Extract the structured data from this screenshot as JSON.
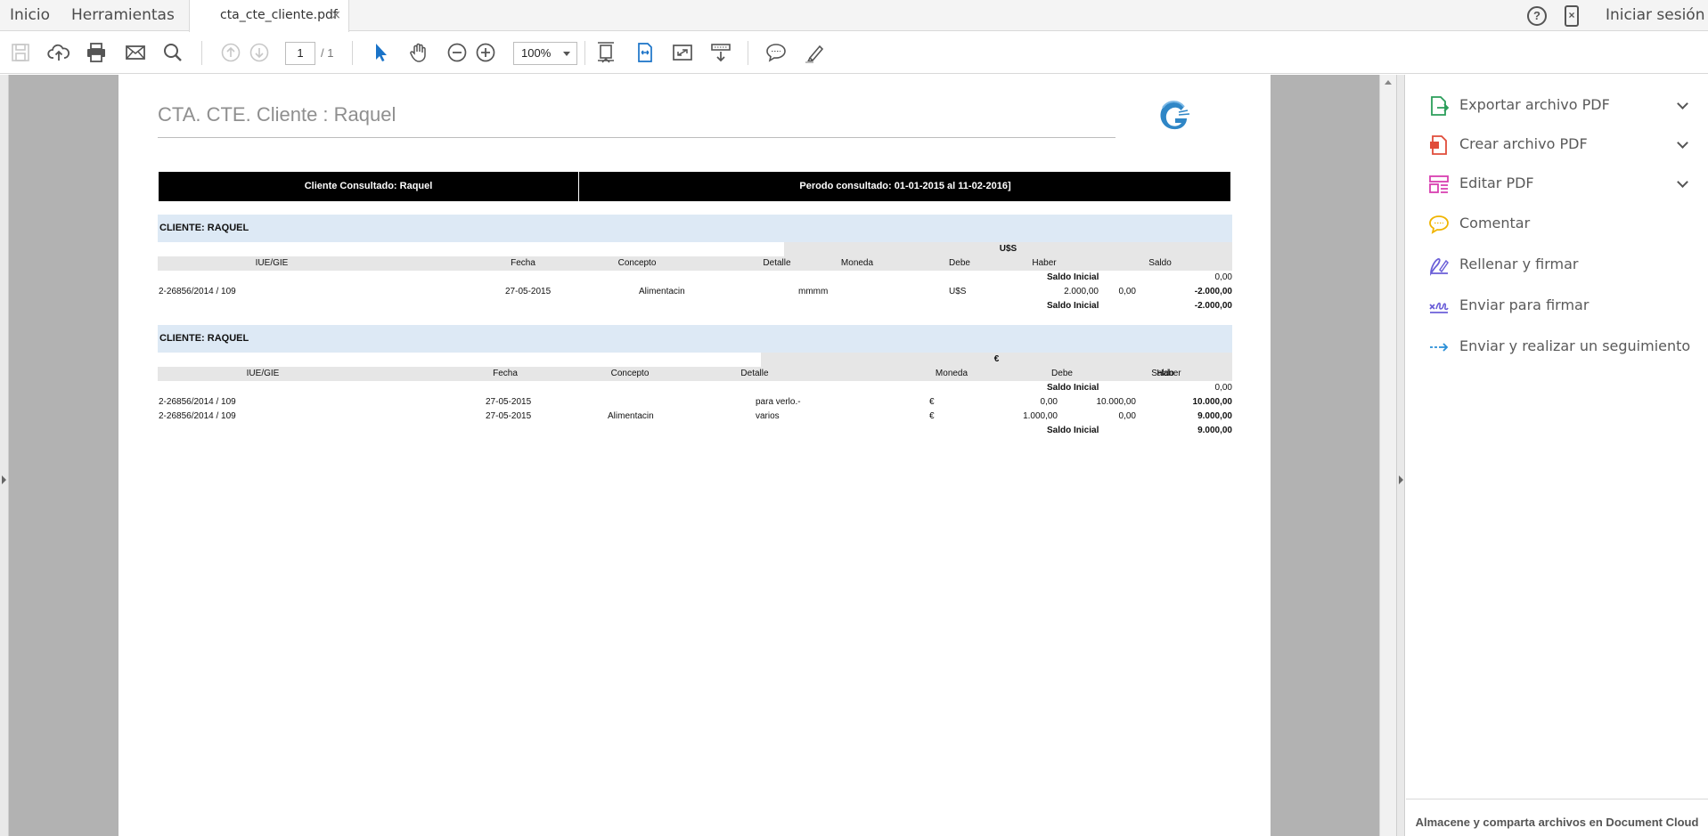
{
  "topbar": {
    "home": "Inicio",
    "tools": "Herramientas",
    "file_tab": "cta_cte_cliente.pdf",
    "close_glyph": "×",
    "help_glyph": "?",
    "sign_in": "Iniciar sesión"
  },
  "toolbar": {
    "page_current": "1",
    "page_total": "/ 1",
    "zoom": "100%",
    "icons": [
      "save-icon",
      "upload-cloud-icon",
      "print-icon",
      "email-icon",
      "search-icon",
      "page-up-icon",
      "page-down-icon",
      "select-arrow-icon",
      "hand-icon",
      "zoom-out-icon",
      "zoom-in-icon",
      "fit-page-icon",
      "fit-width-icon",
      "fullscreen-icon",
      "read-mode-icon",
      "comment-icon",
      "highlight-pen-icon"
    ]
  },
  "panel": {
    "items": [
      {
        "label": "Exportar archivo PDF",
        "icon": "export-pdf-icon",
        "color": "#2b9e5a",
        "expandable": true
      },
      {
        "label": "Crear archivo PDF",
        "icon": "create-pdf-icon",
        "color": "#e04c3a",
        "expandable": true
      },
      {
        "label": "Editar PDF",
        "icon": "edit-pdf-icon",
        "color": "#d83fb0",
        "expandable": true
      },
      {
        "label": "Comentar",
        "icon": "comment-bubble-icon",
        "color": "#f0b400",
        "expandable": false
      },
      {
        "label": "Rellenar y firmar",
        "icon": "fill-sign-icon",
        "color": "#6b5fd8",
        "expandable": false
      },
      {
        "label": "Enviar para firmar",
        "icon": "send-sign-icon",
        "color": "#6b5fd8",
        "expandable": false
      },
      {
        "label": "Enviar y realizar un seguimiento",
        "icon": "send-track-icon",
        "color": "#2a8fd8",
        "expandable": false
      }
    ],
    "footer": "Almacene y comparta archivos en Document Cloud"
  },
  "document": {
    "title": "CTA. CTE. Cliente : Raquel",
    "header_client": "Cliente Consultado: Raquel",
    "header_period": "Perodo consultado: 01-01-2015 al 11-02-2016]",
    "columns": [
      "IUE/GIE",
      "Fecha",
      "Concepto",
      "Detalle",
      "Moneda",
      "Debe",
      "Haber",
      "Saldo"
    ],
    "sections": [
      {
        "client": "CLIENTE: RAQUEL",
        "currency": "U$S",
        "opening": {
          "label": "Saldo Inicial",
          "saldo": "0,00"
        },
        "rows": [
          {
            "iue": "2-26856/2014 / 109",
            "fecha": "27-05-2015",
            "concepto": "Alimentacin",
            "detalle": "mmmm",
            "moneda": "U$S",
            "debe": "2.000,00",
            "haber": "0,00",
            "saldo": "-2.000,00"
          }
        ],
        "closing": {
          "label": "Saldo Inicial",
          "saldo": "-2.000,00"
        }
      },
      {
        "client": "CLIENTE: RAQUEL",
        "currency": "€",
        "opening": {
          "label": "Saldo Inicial",
          "saldo": "0,00"
        },
        "rows": [
          {
            "iue": "2-26856/2014 / 109",
            "fecha": "27-05-2015",
            "concepto": "",
            "detalle": "para verlo.-",
            "moneda": "€",
            "debe": "0,00",
            "haber": "10.000,00",
            "saldo": "10.000,00"
          },
          {
            "iue": "2-26856/2014 / 109",
            "fecha": "27-05-2015",
            "concepto": "Alimentacin",
            "detalle": "varios",
            "moneda": "€",
            "debe": "1.000,00",
            "haber": "0,00",
            "saldo": "9.000,00"
          }
        ],
        "closing": {
          "label": "Saldo Inicial",
          "saldo": "9.000,00"
        }
      }
    ]
  }
}
